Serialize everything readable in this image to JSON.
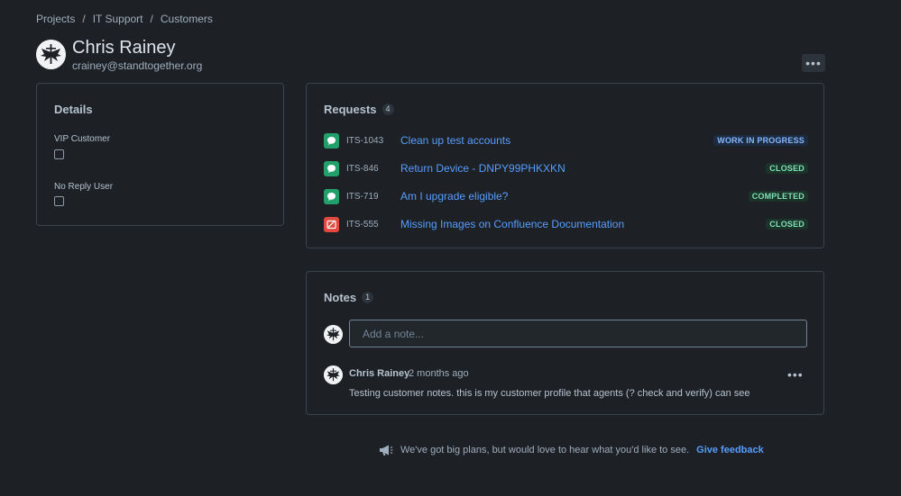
{
  "breadcrumb": {
    "items": [
      "Projects",
      "IT Support",
      "Customers"
    ],
    "separator": "/"
  },
  "customer": {
    "name": "Chris Rainey",
    "email": "crainey@standtogether.org",
    "more_label": "•••"
  },
  "details": {
    "title": "Details",
    "fields": [
      {
        "label": "VIP Customer",
        "checked": false
      },
      {
        "label": "No Reply User",
        "checked": false
      }
    ]
  },
  "requests": {
    "title": "Requests",
    "count": "4",
    "items": [
      {
        "key": "ITS-1043",
        "summary": "Clean up test accounts",
        "status": "WORK IN PROGRESS",
        "status_color": "blue",
        "icon": "chat-bubble-icon",
        "icon_color": "green"
      },
      {
        "key": "ITS-846",
        "summary": "Return Device - DNPY99PHKXKN",
        "status": "CLOSED",
        "status_color": "green",
        "icon": "chat-bubble-icon",
        "icon_color": "green"
      },
      {
        "key": "ITS-719",
        "summary": "Am I upgrade eligible?",
        "status": "COMPLETED",
        "status_color": "green",
        "icon": "chat-bubble-icon",
        "icon_color": "green"
      },
      {
        "key": "ITS-555",
        "summary": "Missing Images on Confluence Documentation",
        "status": "CLOSED",
        "status_color": "green",
        "icon": "broken-image-icon",
        "icon_color": "red"
      }
    ]
  },
  "notes": {
    "title": "Notes",
    "count": "1",
    "input_placeholder": "Add a note...",
    "items": [
      {
        "author": "Chris Rainey",
        "time": "2 months ago",
        "body": "Testing customer notes. this is my customer profile that agents (? check and verify) can see",
        "more_label": "•••"
      }
    ]
  },
  "feedback": {
    "text": "We've got big plans, but would love to hear what you'd like to see.",
    "link": "Give feedback"
  },
  "colors": {
    "background": "#1d2125",
    "link": "#579dff",
    "green_icon": "#22a06b",
    "red_icon": "#e2483d"
  }
}
